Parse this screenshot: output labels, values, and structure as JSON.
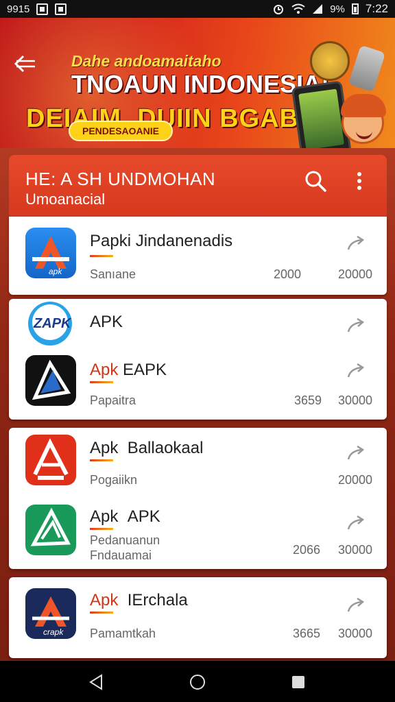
{
  "status_bar": {
    "left_text": "9915",
    "battery_text": "9%",
    "time": "7:22"
  },
  "banner": {
    "line1": "Dahe andoamaitaho",
    "line2": "TNOAUN INDONESIA!",
    "line3": "DEIAIM. DUIIN BGAB.",
    "pill": "PENDESAOANIE"
  },
  "header": {
    "title": "HE: A SH UNDMOHAN",
    "subtitle": "Umoanacial"
  },
  "apps": [
    {
      "name": "Papki Jindanenadis",
      "prefix": "",
      "sub": "Sanıane",
      "sub2": "",
      "num1": "2000",
      "num2": "20000",
      "icon": "apk-a-blue-icon"
    },
    {
      "name": "APK",
      "prefix": "",
      "sub": "",
      "sub2": "",
      "num1": "",
      "num2": "",
      "icon": "zapk-logo-icon"
    },
    {
      "name": "EAPK",
      "prefix": "Apk",
      "sub": "Papaitra",
      "sub2": "",
      "num1": "3659",
      "num2": "30000",
      "icon": "apk-a-black-icon"
    },
    {
      "name": "Ballaokaal",
      "prefix": "Apk",
      "sub": "Pogaiikn",
      "sub2": "",
      "num1": "",
      "num2": "20000",
      "icon": "apk-a-red-icon"
    },
    {
      "name": "APK",
      "prefix": "Apk",
      "sub": "Pedanuanun",
      "sub2": "Fndauamai",
      "num1": "2066",
      "num2": "30000",
      "icon": "apk-a-green-icon"
    },
    {
      "name": "IErchala",
      "prefix": "Apk",
      "sub": "Pamamtkah",
      "sub2": "",
      "num1": "3665",
      "num2": "30000",
      "icon": "apk-a-navy-icon"
    }
  ],
  "colors": {
    "header": "#d7381f",
    "accent": "#ffd21a",
    "banner": "#c01a1a"
  }
}
